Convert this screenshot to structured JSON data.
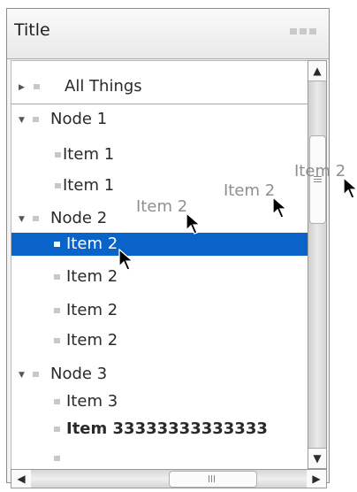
{
  "window": {
    "title": "Title"
  },
  "tree": {
    "rows": [
      {
        "label": "All Things",
        "expander": "▶"
      },
      {
        "label": "Node 1",
        "expander": "▼"
      },
      {
        "label": "Item 1",
        "expander": ""
      },
      {
        "label": "Item 1",
        "expander": ""
      },
      {
        "label": "Node 2",
        "expander": "▼"
      },
      {
        "label": "Item 2",
        "expander": ""
      },
      {
        "label": "Item 2",
        "expander": ""
      },
      {
        "label": "Item 2",
        "expander": ""
      },
      {
        "label": "Item 2",
        "expander": ""
      },
      {
        "label": "Node 3",
        "expander": "▼"
      },
      {
        "label": "Item 3",
        "expander": ""
      },
      {
        "label": "Item 33333333333333",
        "expander": ""
      },
      {
        "label": "",
        "expander": ""
      }
    ],
    "drag_ghosts": [
      "Item 2",
      "Item 2",
      "Item 2"
    ]
  },
  "scrollbars": {
    "up_arrow": "▲",
    "down_arrow": "▼",
    "left_arrow": "◀",
    "right_arrow": "▶"
  },
  "icons": {
    "expander_collapsed": "triangle-right-icon",
    "expander_expanded": "triangle-down-icon",
    "node": "square-bullet-icon",
    "cursor": "arrow-cursor-icon"
  },
  "colors": {
    "selection": "#0a63c9",
    "ghost_text": "#8f8f8f"
  }
}
